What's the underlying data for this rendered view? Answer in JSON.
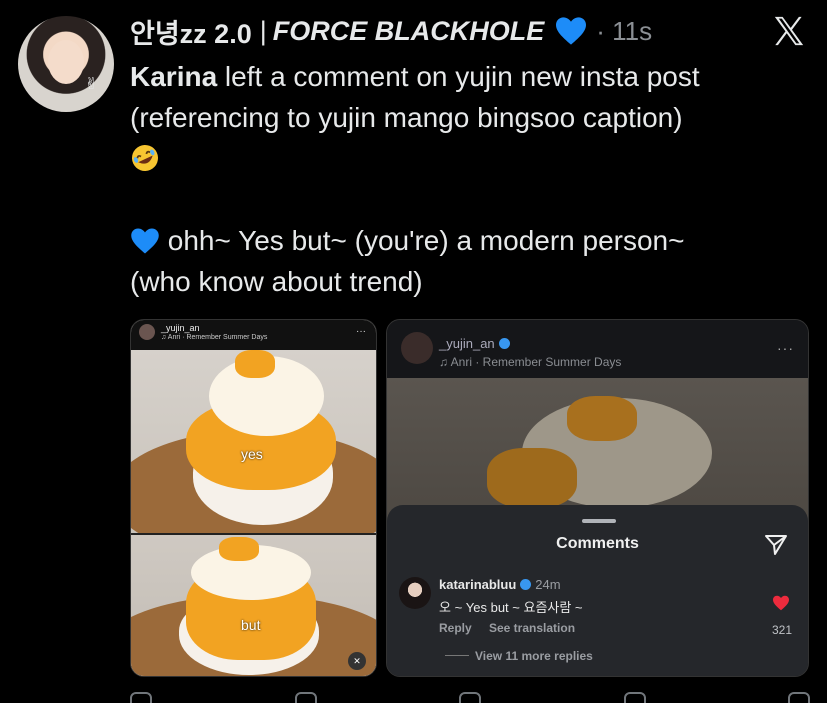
{
  "header": {
    "username": "안녕zz 2.0",
    "separator": "|",
    "display_name": "FORCE BLACKHOLE",
    "time": "· 11s"
  },
  "tweet": {
    "name_bold": "Karina",
    "line1_rest": " left a comment on yujin new insta post",
    "line2": "(referencing to yujin mango bingsoo caption)",
    "translation_line1": " ohh~ Yes but~ (you're) a modern person~",
    "translation_line2": "(who know about trend)"
  },
  "left_image": {
    "username": "_yujin_an",
    "music": "♫ Anri · Remember Summer Days",
    "word_top": "yes",
    "word_bottom": "but"
  },
  "right_image": {
    "username": "_yujin_an",
    "music": "♫ Anri · Remember Summer Days",
    "dots": "···"
  },
  "comments": {
    "title": "Comments",
    "user": "katarinabluu",
    "time": "24m",
    "text": "오 ~ Yes but ~ 요즘사람 ~",
    "reply": "Reply",
    "see_translation": "See translation",
    "likes": "321",
    "view_more": "View 11 more replies"
  },
  "colors": {
    "background": "#000000",
    "text": "#e7e9ea",
    "muted": "#8b8f94",
    "blue_heart": "#1d8cf8",
    "like_red": "#ed2b3d",
    "verified": "#3897f0"
  },
  "icons": [
    "blue-heart-icon",
    "x-logo-icon",
    "rofl-emoji-icon",
    "send-icon",
    "heart-icon",
    "verified-icon",
    "mute-icon"
  ]
}
